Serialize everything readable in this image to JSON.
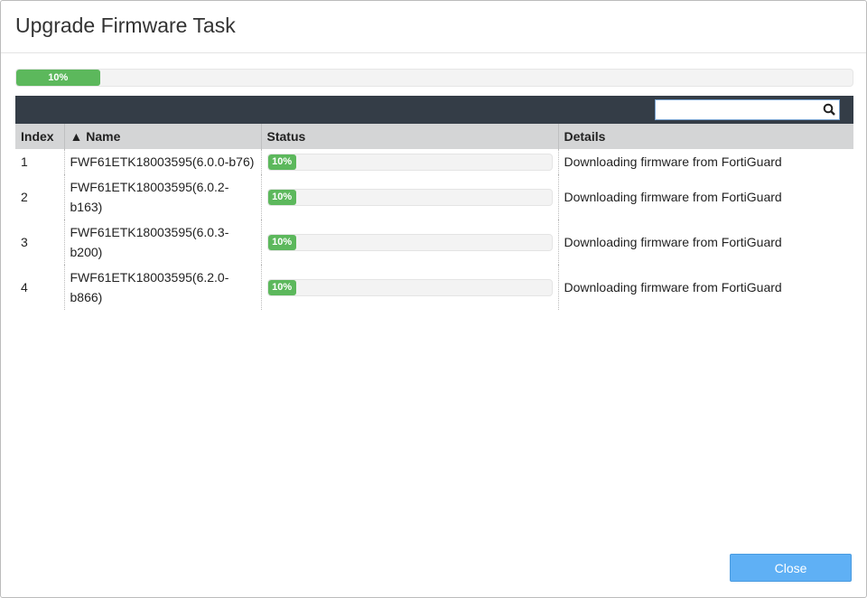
{
  "title": "Upgrade Firmware Task",
  "overall_progress": {
    "percent": 10,
    "label": "10%"
  },
  "search": {
    "value": "",
    "placeholder": ""
  },
  "columns": {
    "index": "Index",
    "name": "▲ Name",
    "status": "Status",
    "details": "Details"
  },
  "rows": [
    {
      "index": "1",
      "name": "FWF61ETK18003595(6.0.0-b76)",
      "percent": 10,
      "status": "10%",
      "details": "Downloading firmware from FortiGuard"
    },
    {
      "index": "2",
      "name": "FWF61ETK18003595(6.0.2-b163)",
      "percent": 10,
      "status": "10%",
      "details": "Downloading firmware from FortiGuard"
    },
    {
      "index": "3",
      "name": "FWF61ETK18003595(6.0.3-b200)",
      "percent": 10,
      "status": "10%",
      "details": "Downloading firmware from FortiGuard"
    },
    {
      "index": "4",
      "name": "FWF61ETK18003595(6.2.0-b866)",
      "percent": 10,
      "status": "10%",
      "details": "Downloading firmware from FortiGuard"
    }
  ],
  "close_label": "Close",
  "colors": {
    "progress": "#5cb85c",
    "toolbar": "#343d47",
    "button": "#5fb0f5"
  }
}
